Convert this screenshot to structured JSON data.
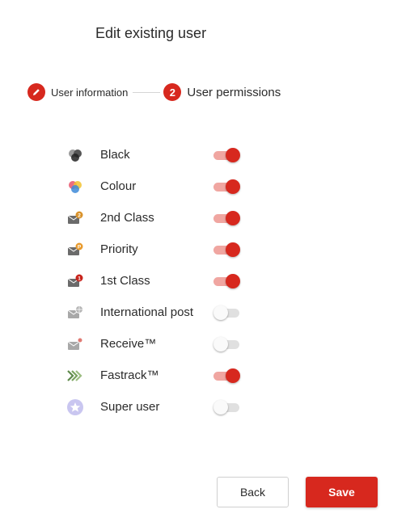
{
  "page": {
    "title": "Edit existing user"
  },
  "stepper": {
    "step1": {
      "label": "User information",
      "icon": "pencil-icon",
      "state": "completed"
    },
    "step2": {
      "number": "2",
      "label": "User permissions",
      "state": "active"
    }
  },
  "permissions": [
    {
      "label": "Black",
      "icon": "black-ink-icon",
      "enabled": true
    },
    {
      "label": "Colour",
      "icon": "colour-ink-icon",
      "enabled": true
    },
    {
      "label": "2nd Class",
      "icon": "second-class-mail-icon",
      "badge": "2",
      "enabled": true
    },
    {
      "label": "Priority",
      "icon": "priority-mail-icon",
      "badge": "P",
      "enabled": true
    },
    {
      "label": "1st Class",
      "icon": "first-class-mail-icon",
      "badge": "1",
      "enabled": true
    },
    {
      "label": "International post",
      "icon": "international-mail-icon",
      "enabled": false
    },
    {
      "label": "Receive™",
      "icon": "receive-mail-icon",
      "enabled": false
    },
    {
      "label": "Fastrack™",
      "icon": "fastrack-icon",
      "enabled": true
    },
    {
      "label": "Super user",
      "icon": "star-icon",
      "enabled": false
    }
  ],
  "buttons": {
    "back": "Back",
    "save": "Save"
  },
  "colors": {
    "accent": "#d7281e",
    "toggle_track_on": "#f0a6a1",
    "toggle_track_off": "#e0e0e0",
    "second_class_badge": "#d9922a",
    "priority_badge": "#e89a2c",
    "first_class_badge": "#c8231b",
    "super_user_circle": "#c9c6f0"
  }
}
